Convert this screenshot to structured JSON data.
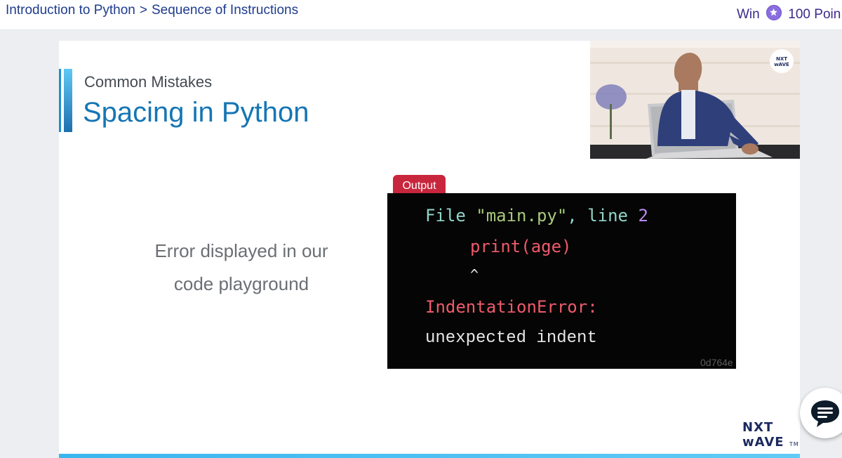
{
  "header": {
    "breadcrumb": [
      "Introduction to Python",
      "Sequence of Instructions"
    ],
    "breadcrumb_separator": ">",
    "reward_prefix": "Win",
    "reward_points": "100 Poin",
    "reward_icon": "star-coin-icon"
  },
  "slide": {
    "subtitle": "Common Mistakes",
    "title": "Spacing in Python",
    "description_line1": "Error displayed in our",
    "description_line2": "code playground",
    "output_tag": "Output",
    "terminal": {
      "line1_file": "File ",
      "line1_name": "\"main.py\"",
      "line1_comma": ", line ",
      "line1_num": "2",
      "line2": "print(age)",
      "line3": "^",
      "line4": "IndentationError:",
      "line5": "unexpected indent"
    },
    "watermark": "0d764e",
    "video_logo_line1": "NXT",
    "video_logo_line2": "wAVE",
    "logo_line1": "NXT",
    "logo_line2": "wAVE",
    "logo_tm": "TM"
  },
  "chat": {
    "icon": "chat-bubble-icon"
  },
  "colors": {
    "breadcrumb": "#1f3c8e",
    "title": "#1676b4",
    "output_tag": "#c8263d",
    "error": "#ee5a6b"
  }
}
